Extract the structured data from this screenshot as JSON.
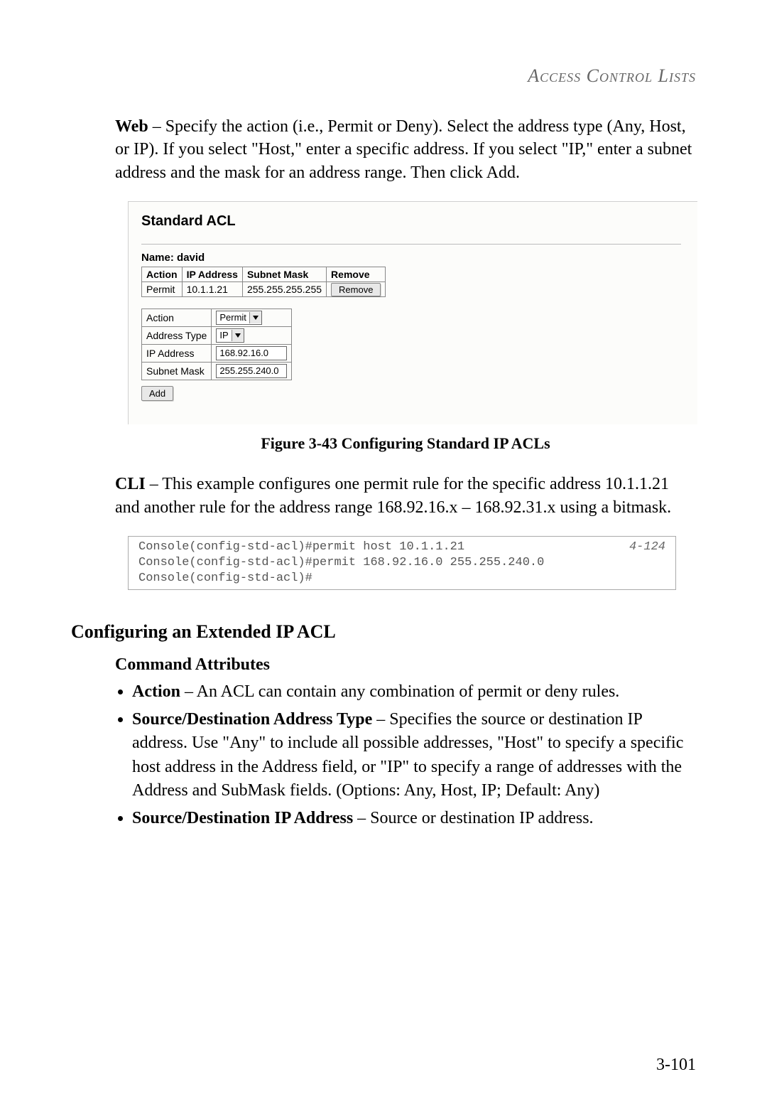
{
  "header": {
    "section_title": "Access Control Lists"
  },
  "intro": {
    "web_label": "Web",
    "web_text": " – Specify the action (i.e., Permit or Deny). Select the address type (Any, Host, or IP). If you select \"Host,\" enter a specific address. If you select \"IP,\" enter a subnet address and the mask for an address range. Then click Add."
  },
  "figure": {
    "panel_title": "Standard ACL",
    "name_label": "Name: ",
    "name_value": "david",
    "table": {
      "col_action": "Action",
      "col_ip": "IP Address",
      "col_mask": "Subnet Mask",
      "col_remove": "Remove",
      "row1": {
        "action": "Permit",
        "ip": "10.1.1.21",
        "mask": "255.255.255.255",
        "remove_btn": "Remove"
      }
    },
    "form": {
      "action_label": "Action",
      "action_value": "Permit",
      "addrtype_label": "Address Type",
      "addrtype_value": "IP",
      "ip_label": "IP Address",
      "ip_value": "168.92.16.0",
      "mask_label": "Subnet Mask",
      "mask_value": "255.255.240.0",
      "add_btn": "Add"
    },
    "caption": "Figure 3-43  Configuring Standard IP ACLs"
  },
  "cli": {
    "cli_label": "CLI",
    "cli_text": " – This example configures one permit rule for the specific address 10.1.1.21 and another rule for the address range 168.92.16.x – 168.92.31.x using a bitmask.",
    "line1": "Console(config-std-acl)#permit host 10.1.1.21",
    "line2": "Console(config-std-acl)#permit 168.92.16.0 255.255.240.0",
    "line3": "Console(config-std-acl)#",
    "page_ref": "4-124"
  },
  "ext_acl": {
    "heading": "Configuring an Extended IP ACL",
    "subheading": "Command Attributes",
    "bullet1_label": "Action",
    "bullet1_text": " – An ACL can contain any combination of permit or deny rules.",
    "bullet2_label": "Source/Destination Address Type",
    "bullet2_text": " – Specifies the source or destination IP address. Use \"Any\" to include all possible addresses, \"Host\" to specify a specific host address in the Address field, or \"IP\" to specify a range of addresses with the Address and SubMask fields. (Options: Any, Host, IP; Default: Any)",
    "bullet3_label": "Source/Destination IP Address",
    "bullet3_text": " – Source or destination IP address."
  },
  "page_number": "3-101"
}
